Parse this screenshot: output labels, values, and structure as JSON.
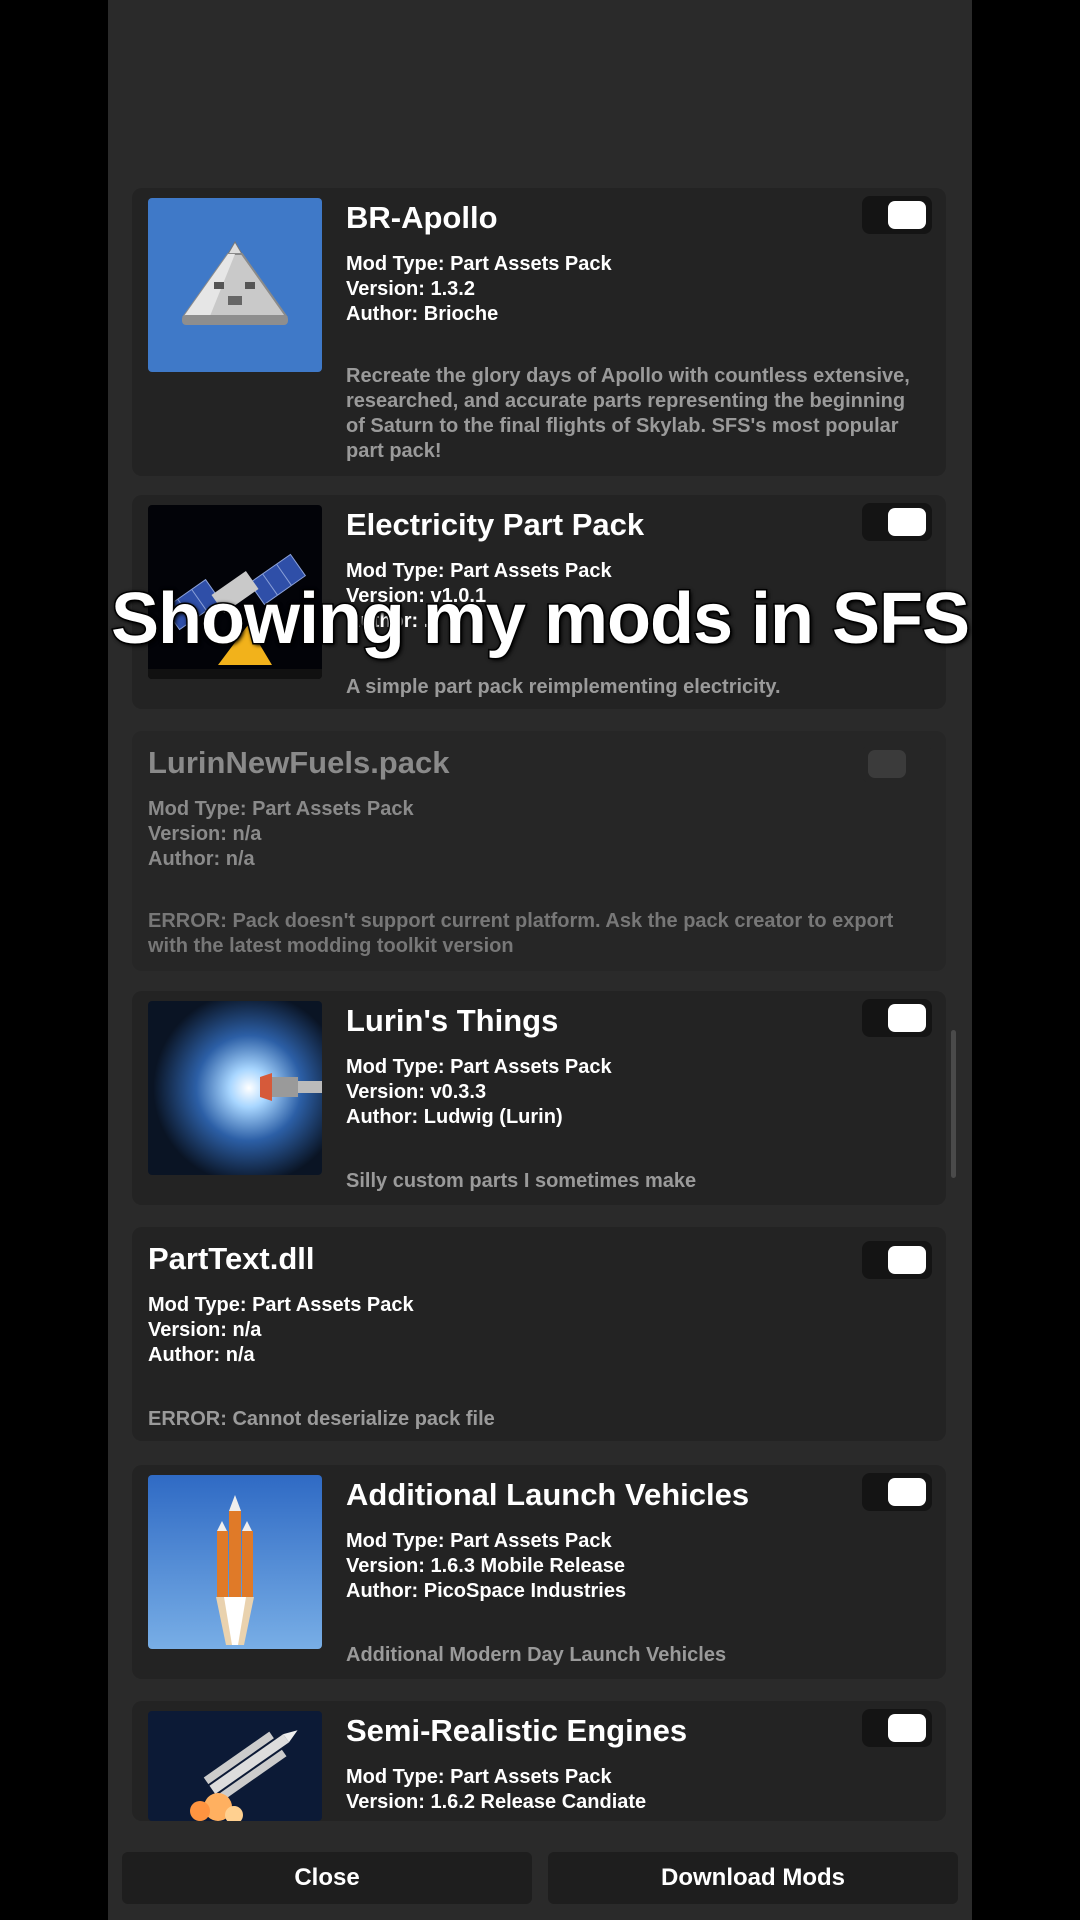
{
  "overlay_caption": "Showing my mods in SFS",
  "labels": {
    "mod_type_prefix": "Mod Type: ",
    "version_prefix": "Version: ",
    "author_prefix": "Author: "
  },
  "mods": [
    {
      "name": "BR-Apollo",
      "mod_type": "Part Assets Pack",
      "version": "1.3.2",
      "author": "Brioche",
      "description": "Recreate the glory days of Apollo with countless extensive, researched, and accurate parts representing the beginning of Saturn to the final flights of Skylab. SFS's most popular part pack!",
      "enabled": true,
      "icon": "apollo-capsule-icon"
    },
    {
      "name": "Electricity Part Pack",
      "mod_type": "Part Assets Pack",
      "version": "v1.0.1",
      "author": "...",
      "description": "A simple part pack reimplementing electricity.",
      "enabled": true,
      "icon": "satellite-electricity-icon"
    },
    {
      "name": "LurinNewFuels.pack",
      "mod_type": "Part Assets Pack",
      "version": "n/a",
      "author": "n/a",
      "description": "ERROR: Pack doesn't support current platform. Ask the pack creator to export with the latest modding toolkit version",
      "enabled": false
    },
    {
      "name": "Lurin's Things",
      "mod_type": "Part Assets Pack",
      "version": "v0.3.3",
      "author": "Ludwig (Lurin)",
      "description": "Silly custom parts I sometimes make",
      "enabled": true,
      "icon": "engine-plume-icon"
    },
    {
      "name": "PartText.dll",
      "mod_type": "Part Assets Pack",
      "version": "n/a",
      "author": "n/a",
      "description": "ERROR: Cannot deserialize pack file",
      "enabled": true
    },
    {
      "name": "Additional Launch Vehicles",
      "mod_type": "Part Assets Pack",
      "version": "1.6.3 Mobile Release",
      "author": "PicoSpace Industries",
      "description": "Additional Modern Day Launch Vehicles",
      "enabled": true,
      "icon": "rocket-launch-icon"
    },
    {
      "name": "Semi-Realistic Engines",
      "mod_type": "Part Assets Pack",
      "version": "1.6.2 Release Candiate",
      "enabled": true,
      "icon": "rocket-engines-icon"
    }
  ],
  "buttons": {
    "close": "Close",
    "download": "Download Mods"
  },
  "colors": {
    "panel": "#2a2a2a",
    "card": "#232323",
    "toggle_on_knob": "#ffffff",
    "text_secondary": "#9a9a9a"
  }
}
